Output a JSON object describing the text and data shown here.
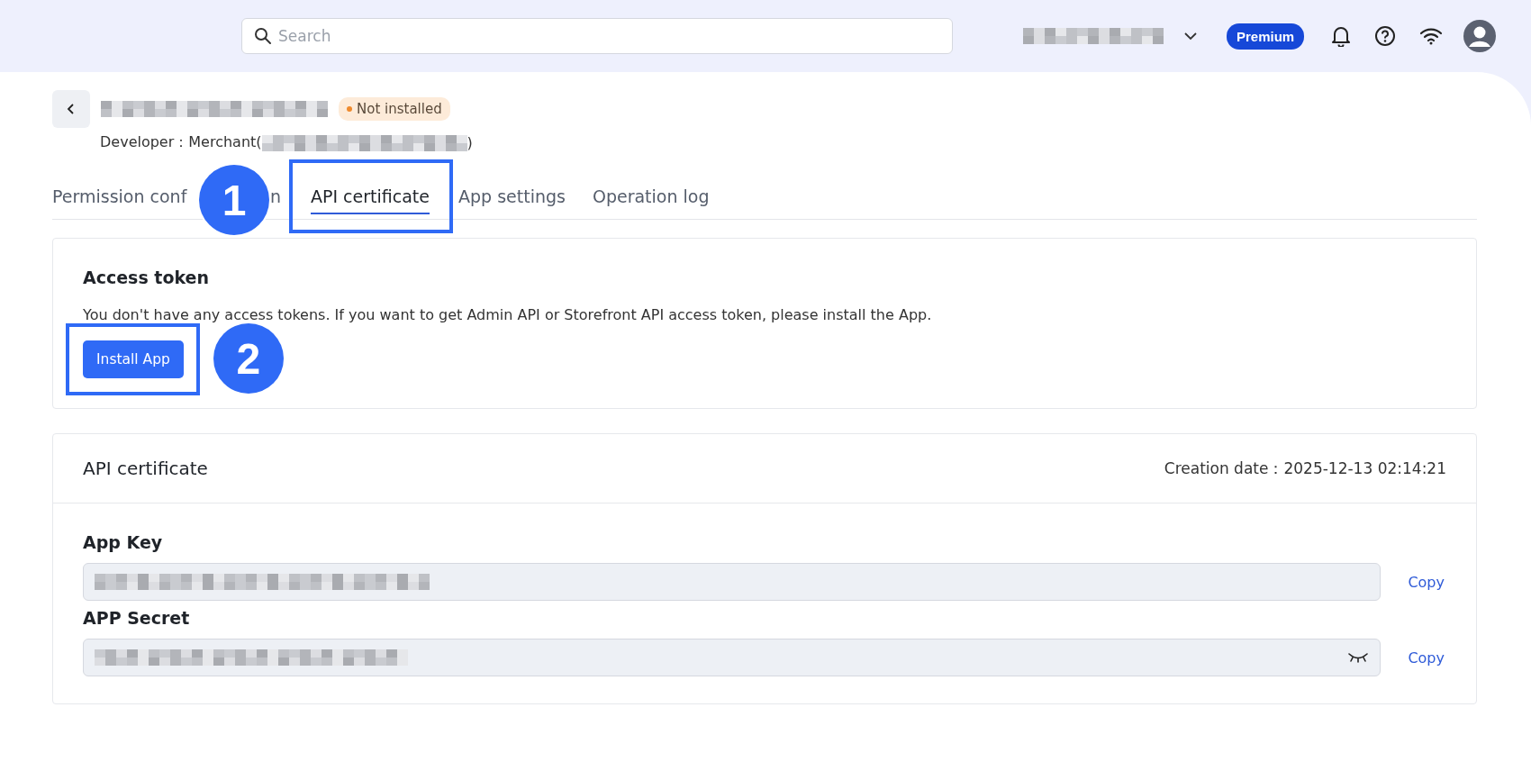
{
  "top_bar": {
    "search": {
      "placeholder": "Search"
    },
    "plan_badge": "Premium"
  },
  "app": {
    "status": "Not installed",
    "developer_label": "Developer：Merchant(",
    "developer_close": ")"
  },
  "tabs": [
    {
      "label": "Permission conf",
      "label_tail": "n",
      "selected": false
    },
    {
      "label": "API certificate",
      "selected": true
    },
    {
      "label": "App settings",
      "selected": false
    },
    {
      "label": "Operation log",
      "selected": false
    }
  ],
  "annotations": [
    {
      "number": "1"
    },
    {
      "number": "2"
    }
  ],
  "access_token": {
    "title": "Access token",
    "message": "You don't have any access tokens. If you want to get Admin API or Storefront API access token, please install the App.",
    "button": "Install App"
  },
  "api_certificate": {
    "title": "API certificate",
    "creation_date": "Creation date：2025-12-13 02:14:21",
    "fields": [
      {
        "label": "App Key",
        "action": "Copy",
        "hidden": false
      },
      {
        "label": "APP Secret",
        "action": "Copy",
        "hidden": true
      }
    ]
  }
}
